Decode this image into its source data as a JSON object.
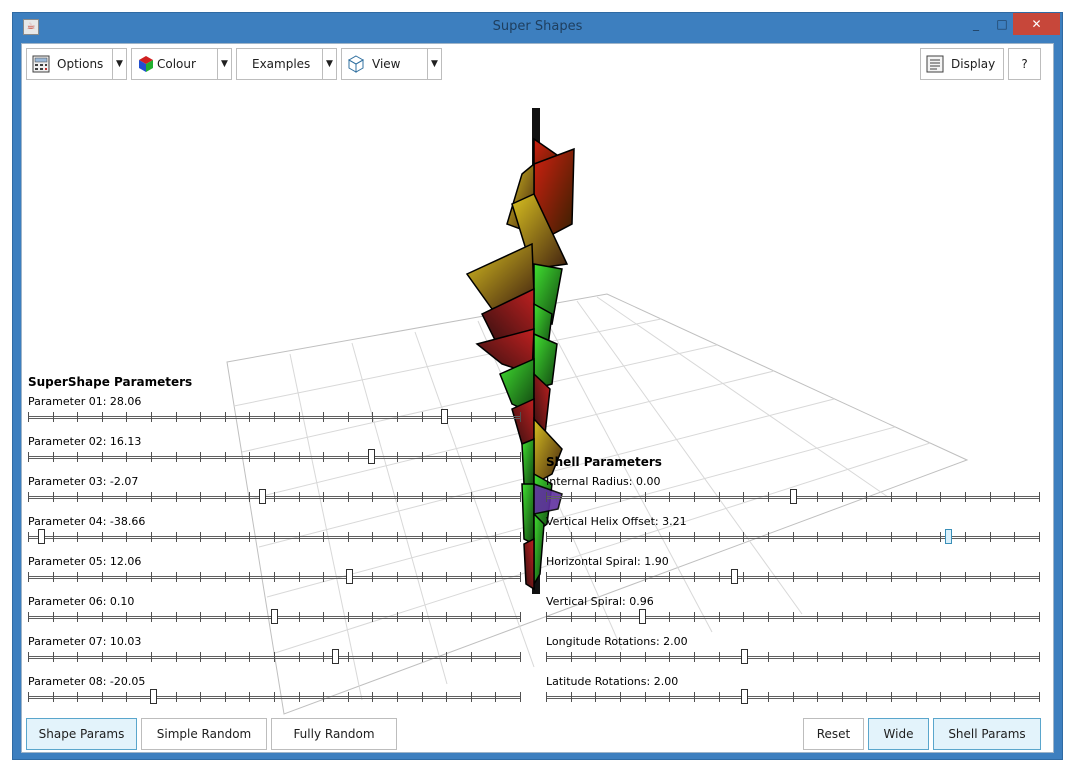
{
  "window": {
    "title": "Super Shapes",
    "minimize": "_",
    "maximize": "□",
    "close": "✕"
  },
  "toolbar": {
    "options": "Options",
    "colour": "Colour",
    "examples": "Examples",
    "view": "View",
    "display": "Display",
    "help": "?",
    "dropdown_arrow": "▼"
  },
  "supershape": {
    "heading": "SuperShape Parameters",
    "params": [
      {
        "label": "Parameter 01: 28.06",
        "value": 0.85
      },
      {
        "label": "Parameter 02: 16.13",
        "value": 0.7
      },
      {
        "label": "Parameter 03: -2.07",
        "value": 0.475
      },
      {
        "label": "Parameter 04: -38.66",
        "value": 0.02
      },
      {
        "label": "Parameter 05: 12.06",
        "value": 0.655
      },
      {
        "label": "Parameter 06: 0.10",
        "value": 0.5
      },
      {
        "label": "Parameter 07: 10.03",
        "value": 0.625
      },
      {
        "label": "Parameter 08: -20.05",
        "value": 0.25
      }
    ]
  },
  "shell": {
    "heading": "Shell Parameters",
    "params": [
      {
        "label": "Internal Radius: 0.00",
        "value": 0.5
      },
      {
        "label": "Vertical Helix Offset: 3.21",
        "value": 0.82
      },
      {
        "label": "Horizontal Spiral: 1.90",
        "value": 0.38
      },
      {
        "label": "Vertical Spiral: 0.96",
        "value": 0.19
      },
      {
        "label": "Longitude Rotations: 2.00",
        "value": 0.4
      },
      {
        "label": "Latitude Rotations: 2.00",
        "value": 0.4
      }
    ]
  },
  "buttons": {
    "shape_params": "Shape Params",
    "simple_random": "Simple Random",
    "fully_random": "Fully Random",
    "reset": "Reset",
    "wide": "Wide",
    "shell_params": "Shell Params"
  },
  "colors": {
    "title_bar": "#3d7fbf",
    "close_button": "#c7473a",
    "active_button": "#e3f3fb",
    "shape_red": "#b01818",
    "shape_green": "#30c020",
    "shape_dark": "#202010"
  }
}
